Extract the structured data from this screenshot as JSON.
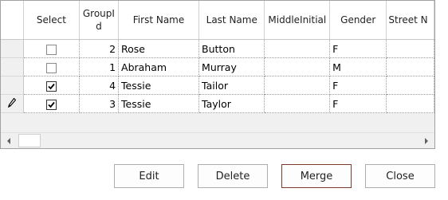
{
  "grid": {
    "columns": [
      "Select",
      "GroupId",
      "First Name",
      "Last Name",
      "MiddleInitial",
      "Gender",
      "Street N"
    ],
    "rows": [
      {
        "selected": false,
        "editing": false,
        "group_id": "2",
        "first_name": "Rose",
        "last_name": "Button",
        "middle_initial": "",
        "gender": "F",
        "street": ""
      },
      {
        "selected": false,
        "editing": false,
        "group_id": "1",
        "first_name": "Abraham",
        "last_name": "Murray",
        "middle_initial": "",
        "gender": "M",
        "street": ""
      },
      {
        "selected": true,
        "editing": false,
        "group_id": "4",
        "first_name": "Tessie",
        "last_name": "Tailor",
        "middle_initial": "",
        "gender": "F",
        "street": ""
      },
      {
        "selected": true,
        "editing": true,
        "group_id": "3",
        "first_name": "Tessie",
        "last_name": "Taylor",
        "middle_initial": "",
        "gender": "F",
        "street": ""
      }
    ],
    "row_header_icon_editing": "pencil-icon"
  },
  "scrollbar": {
    "left_icon": "scroll-left-arrow-icon",
    "right_icon": "scroll-right-arrow-icon"
  },
  "buttons": {
    "edit": "Edit",
    "delete": "Delete",
    "merge": "Merge",
    "close": "Close"
  },
  "colors": {
    "primary_button_border": "#7a3b2e",
    "grid_background": "#f0f0f0"
  }
}
